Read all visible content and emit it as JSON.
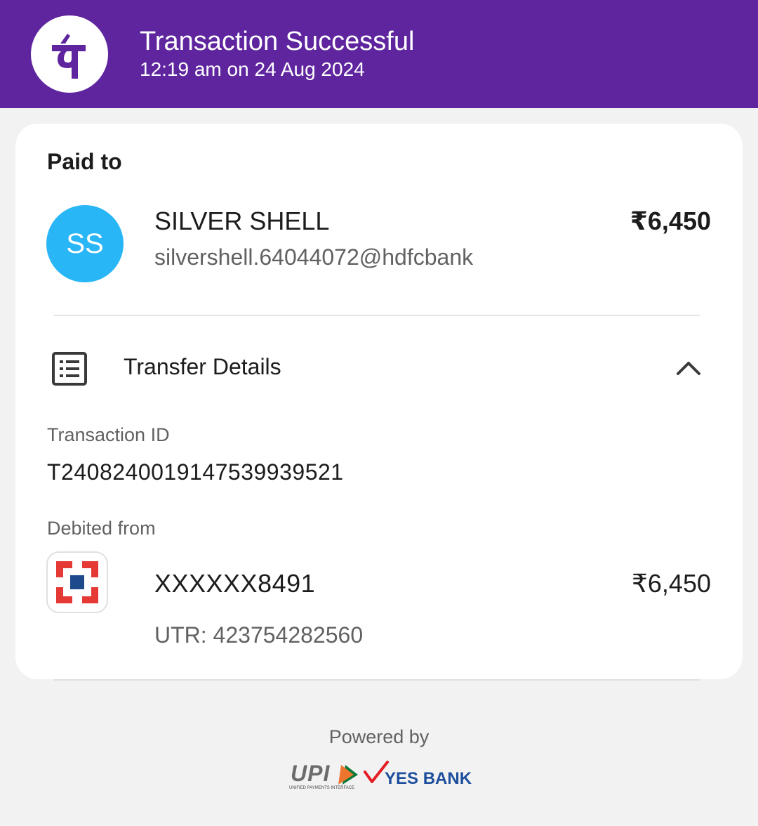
{
  "header": {
    "logo_icon": "phonepe-logo-icon",
    "title": "Transaction Successful",
    "timestamp": "12:19 am on 24 Aug 2024",
    "color": "#5f259f"
  },
  "payee": {
    "section_label": "Paid to",
    "avatar_initials": "SS",
    "avatar_color": "#29b6f6",
    "name": "SILVER SHELL",
    "vpa": "silvershell.64044072@hdfcbank",
    "amount": "₹6,450"
  },
  "transfer_details": {
    "icon": "receipt-list-icon",
    "title": "Transfer Details",
    "toggle_icon": "chevron-up-icon",
    "transaction_id_label": "Transaction ID",
    "transaction_id": "T2408240019147539939521",
    "debited_from_label": "Debited from",
    "bank_logo_icon": "hdfc-bank-logo-icon",
    "account": "XXXXXX8491",
    "amount": "₹6,450",
    "utr": "UTR: 423754282560"
  },
  "footer": {
    "powered_by": "Powered by",
    "upi_logo_text": "UPI",
    "upi_tagline": "UNIFIED PAYMENTS INTERFACE",
    "bank_logo_text": "YES BANK"
  }
}
